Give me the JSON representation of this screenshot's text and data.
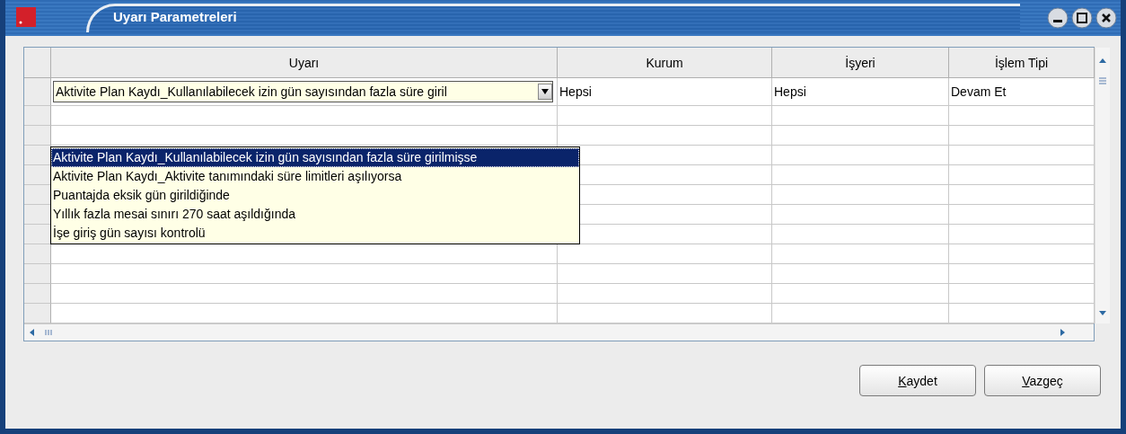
{
  "window": {
    "title": "Uyarı Parametreleri"
  },
  "table": {
    "columns": [
      "Uyarı",
      "Kurum",
      "İşyeri",
      "İşlem Tipi"
    ],
    "rows": [
      {
        "cells": [
          "Aktivite Plan Kaydı_Kullanılabilecek izin gün sayısından fazla süre giril",
          "Hepsi",
          "Hepsi",
          "Devam Et"
        ]
      }
    ]
  },
  "dropdown": {
    "options": [
      {
        "label": "Aktivite Plan Kaydı_Kullanılabilecek izin gün sayısından fazla süre girilmişse",
        "selected": true
      },
      {
        "label": "Aktivite Plan Kaydı_Aktivite tanımındaki süre limitleri aşılıyorsa",
        "selected": false
      },
      {
        "label": "Puantajda eksik gün girildiğinde",
        "selected": false
      },
      {
        "label": "Yıllık fazla mesai sınırı 270 saat aşıldığında",
        "selected": false
      },
      {
        "label": "İşe giriş gün sayısı kontrolü",
        "selected": false
      }
    ]
  },
  "buttons": [
    {
      "label": "Kaydet"
    },
    {
      "label": "Vazgeç"
    }
  ]
}
